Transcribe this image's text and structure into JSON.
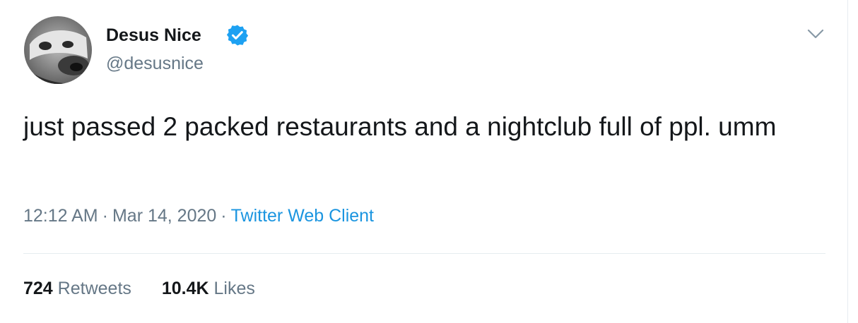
{
  "author": {
    "display_name": "Desus Nice",
    "handle": "@desusnice",
    "verified": true,
    "avatar_icon": "profile-avatar"
  },
  "tweet": {
    "text": "just passed 2 packed restaurants and a nightclub full of ppl. umm",
    "time": "12:12 AM",
    "separator": "·",
    "date": "Mar 14, 2020",
    "source": "Twitter Web Client"
  },
  "stats": {
    "retweets_count": "724",
    "retweets_label": "Retweets",
    "likes_count": "10.4K",
    "likes_label": "Likes"
  },
  "colors": {
    "accent": "#1b95e0",
    "verified_badge": "#1da1f2",
    "secondary_text": "#657786",
    "primary_text": "#14171a"
  },
  "icons": {
    "verified": "verified-badge-icon",
    "more": "chevron-down-icon"
  }
}
